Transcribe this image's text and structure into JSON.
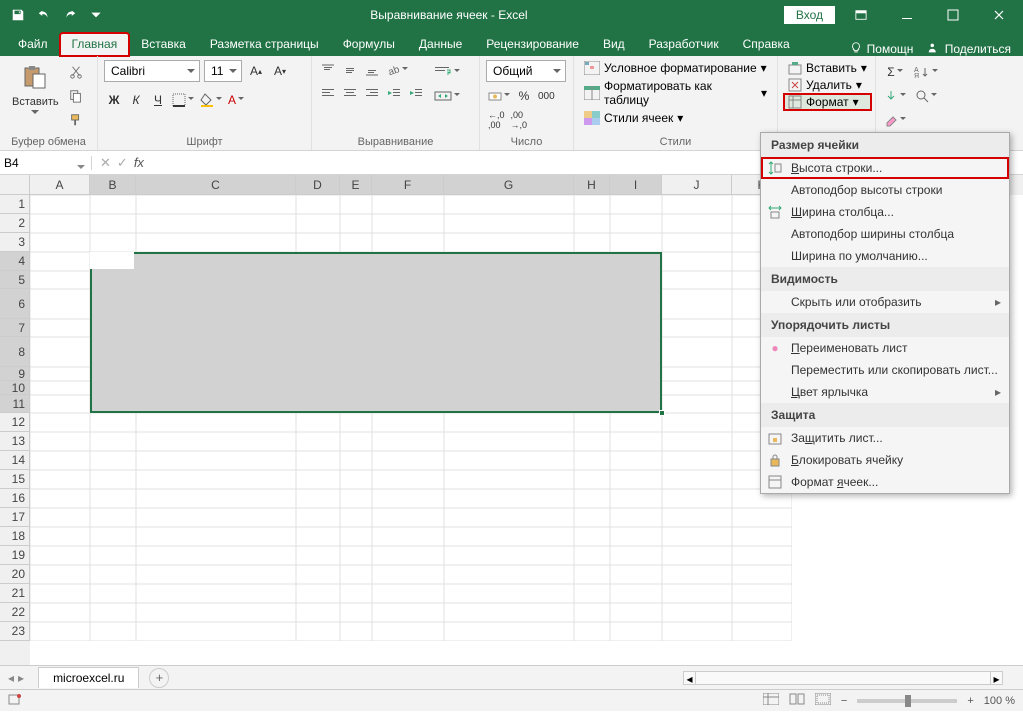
{
  "title": "Выравнивание ячеек  -  Excel",
  "login": "Вход",
  "tabs": [
    "Файл",
    "Главная",
    "Вставка",
    "Разметка страницы",
    "Формулы",
    "Данные",
    "Рецензирование",
    "Вид",
    "Разработчик",
    "Справка"
  ],
  "help": "Помощн",
  "share": "Поделиться",
  "ribbon": {
    "clipboard": {
      "paste": "Вставить",
      "label": "Буфер обмена"
    },
    "font": {
      "name": "Calibri",
      "size": "11",
      "label": "Шрифт"
    },
    "align": {
      "label": "Выравнивание"
    },
    "number": {
      "format": "Общий",
      "label": "Число"
    },
    "styles": {
      "cond": "Условное форматирование",
      "table": "Форматировать как таблицу",
      "cell": "Стили ячеек",
      "label": "Стили"
    },
    "cells": {
      "insert": "Вставить",
      "delete": "Удалить",
      "format": "Формат"
    },
    "editing": {}
  },
  "namebox": "B4",
  "cols": [
    {
      "l": "A",
      "w": 60
    },
    {
      "l": "B",
      "w": 46
    },
    {
      "l": "C",
      "w": 160
    },
    {
      "l": "D",
      "w": 44
    },
    {
      "l": "E",
      "w": 32
    },
    {
      "l": "F",
      "w": 72
    },
    {
      "l": "G",
      "w": 130
    },
    {
      "l": "H",
      "w": 36
    },
    {
      "l": "I",
      "w": 52
    },
    {
      "l": "J",
      "w": 70
    },
    {
      "l": "K",
      "w": 60
    }
  ],
  "rows": [
    {
      "n": 1,
      "h": 19
    },
    {
      "n": 2,
      "h": 19
    },
    {
      "n": 3,
      "h": 19
    },
    {
      "n": 4,
      "h": 19
    },
    {
      "n": 5,
      "h": 18
    },
    {
      "n": 6,
      "h": 30
    },
    {
      "n": 7,
      "h": 18
    },
    {
      "n": 8,
      "h": 30
    },
    {
      "n": 9,
      "h": 14
    },
    {
      "n": 10,
      "h": 14
    },
    {
      "n": 11,
      "h": 18
    },
    {
      "n": 12,
      "h": 19
    },
    {
      "n": 13,
      "h": 19
    },
    {
      "n": 14,
      "h": 19
    },
    {
      "n": 15,
      "h": 19
    },
    {
      "n": 16,
      "h": 19
    },
    {
      "n": 17,
      "h": 19
    },
    {
      "n": 18,
      "h": 19
    },
    {
      "n": 19,
      "h": 19
    },
    {
      "n": 20,
      "h": 19
    },
    {
      "n": 21,
      "h": 19
    },
    {
      "n": 22,
      "h": 19
    },
    {
      "n": 23,
      "h": 19
    }
  ],
  "dropdown": {
    "h1": "Размер ячейки",
    "i1": "Высота строки...",
    "i2": "Автоподбор высоты строки",
    "i3": "Ширина столбца...",
    "i4": "Автоподбор ширины столбца",
    "i5": "Ширина по умолчанию...",
    "h2": "Видимость",
    "i6": "Скрыть или отобразить",
    "h3": "Упорядочить листы",
    "i7": "Переименовать лист",
    "i8": "Переместить или скопировать лист...",
    "i9": "Цвет ярлычка",
    "h4": "Защита",
    "i10": "Защитить лист...",
    "i11": "Блокировать ячейку",
    "i12": "Формат ячеек..."
  },
  "sheet": "microexcel.ru",
  "zoom": "100 %"
}
